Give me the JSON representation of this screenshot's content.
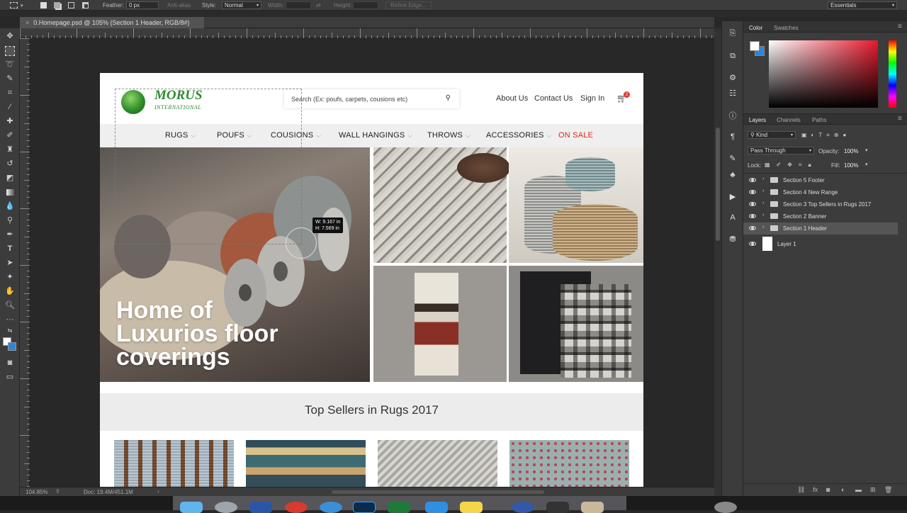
{
  "options_bar": {
    "feather_label": "Feather:",
    "feather_value": "0 px",
    "anti_alias_label": "Anti-alias",
    "style_label": "Style:",
    "style_value": "Normal",
    "width_label": "Width:",
    "height_label": "Height:",
    "refine_edge_label": "Refine Edge...",
    "workspace_value": "Essentials"
  },
  "document_tab": {
    "title": "0.Homepage.psd @ 105% (Section 1 Header, RGB/8#)"
  },
  "status_bar": {
    "zoom": "104.85%",
    "doc_size": "Doc: 19.4M/451.1M"
  },
  "measure_tooltip": {
    "width": "W: 9.167 in",
    "height": "H: 7.569 in"
  },
  "website": {
    "logo_name": "MORUS",
    "logo_sub": "INTERNATIONAL",
    "search_placeholder": "Search (Ex: poufs, carpets, cousions etc)",
    "header_links": [
      "About Us",
      "Contact Us",
      "Sign In"
    ],
    "cart_count": "2",
    "nav": [
      "RUGS",
      "POUFS",
      "COUSIONS",
      "WALL HANGINGS",
      "THROWS",
      "ACCESSORIES",
      "ON SALE"
    ],
    "hero_text": [
      "Home of",
      "Luxurios floor",
      "coverings"
    ],
    "section_title": "Top Sellers in Rugs 2017"
  },
  "color_panel": {
    "tabs": [
      "Color",
      "Swatches"
    ],
    "hue_color": "#e8192c"
  },
  "layers_panel": {
    "tabs": [
      "Layers",
      "Channels",
      "Paths"
    ],
    "filter_kind": "Kind",
    "blend_mode": "Pass Through",
    "opacity_label": "Opacity:",
    "opacity_value": "100%",
    "lock_label": "Lock:",
    "fill_label": "Fill:",
    "fill_value": "100%",
    "layers": [
      {
        "name": "Section 5 Footer",
        "type": "group"
      },
      {
        "name": "Section 4 New Range",
        "type": "group"
      },
      {
        "name": "Section 3 Top Sellers in Rugs 2017",
        "type": "group"
      },
      {
        "name": "Section 2 Banner",
        "type": "group"
      },
      {
        "name": "Section 1 Header",
        "type": "group",
        "selected": true
      },
      {
        "name": "Layer 1",
        "type": "layer"
      }
    ]
  },
  "accent": {
    "green": "#2e8b2e",
    "sale_red": "#d62b20",
    "ps_bg": "#282828",
    "panel_bg": "#3c3c3c"
  }
}
